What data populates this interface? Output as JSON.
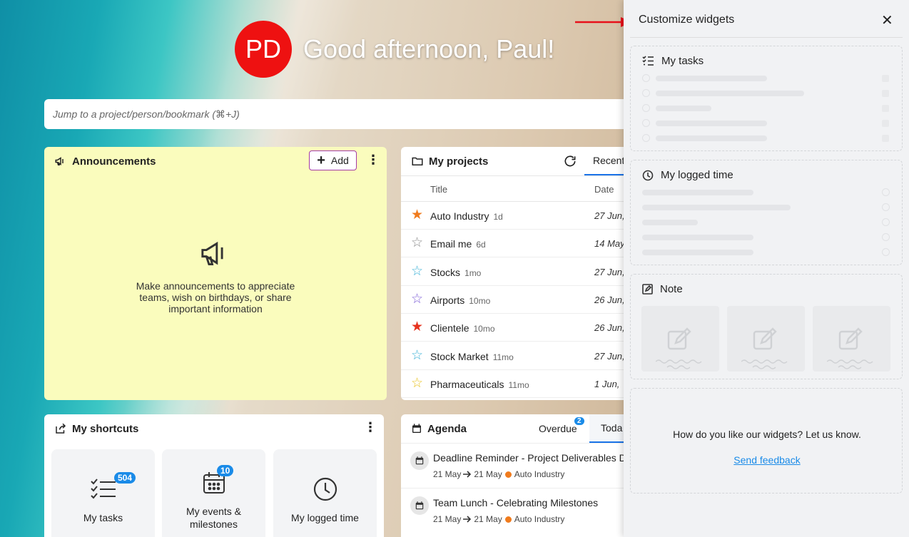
{
  "header": {
    "avatar_initials": "PD",
    "greeting": "Good afternoon, Paul!",
    "avatar_color": "#ee1111"
  },
  "search": {
    "placeholder": "Jump to a project/person/bookmark (⌘+J)"
  },
  "announcements": {
    "title": "Announcements",
    "add_label": "Add",
    "empty_text": "Make announcements to appreciate teams, wish on birthdays, or share important information",
    "background": "#fafcbd"
  },
  "projects": {
    "title": "My projects",
    "tab": "Recent",
    "col_title": "Title",
    "col_date": "Date",
    "rows": [
      {
        "name": "Auto Industry",
        "age": "1d",
        "date": "27 Jun,",
        "star": "filled",
        "star_color": "#f07b1d"
      },
      {
        "name": "Email me",
        "age": "6d",
        "date": "14 May",
        "star": "outline",
        "star_color": "#8a8a8a"
      },
      {
        "name": "Stocks",
        "age": "1mo",
        "date": "27 Jun,",
        "star": "outline",
        "star_color": "#3bb1d6"
      },
      {
        "name": "Airports",
        "age": "10mo",
        "date": "26 Jun,",
        "star": "outline",
        "star_color": "#7b5cd6"
      },
      {
        "name": "Clientele",
        "age": "10mo",
        "date": "26 Jun,",
        "star": "filled",
        "star_color": "#e6321e"
      },
      {
        "name": "Stock Market",
        "age": "11mo",
        "date": "27 Jun,",
        "star": "outline",
        "star_color": "#3bb1d6"
      },
      {
        "name": "Pharmaceuticals",
        "age": "11mo",
        "date": "1 Jun,",
        "star": "outline",
        "star_color": "#e8c21e"
      }
    ]
  },
  "shortcuts": {
    "title": "My shortcuts",
    "tiles": [
      {
        "label": "My tasks",
        "badge": "504"
      },
      {
        "label": "My events & milestones",
        "badge": "10"
      },
      {
        "label": "My logged time",
        "badge": ""
      }
    ]
  },
  "agenda": {
    "title": "Agenda",
    "tab_overdue": "Overdue",
    "overdue_count": "2",
    "tab_today": "Toda",
    "items": [
      {
        "title": "Deadline Reminder - Project Deliverables D",
        "from": "21 May",
        "to": "21 May",
        "project": "Auto Industry"
      },
      {
        "title": "Team Lunch - Celebrating Milestones",
        "from": "21 May",
        "to": "21 May",
        "project": "Auto Industry"
      }
    ]
  },
  "panel": {
    "title": "Customize widgets",
    "w_tasks": "My tasks",
    "w_logged": "My logged time",
    "w_note": "Note",
    "feedback_text": "How do you like our widgets? Let us know.",
    "feedback_link": "Send feedback"
  },
  "colors": {
    "accent": "#1a8be8",
    "arrow": "#e8101a",
    "project_dot": "#f07b1d"
  }
}
